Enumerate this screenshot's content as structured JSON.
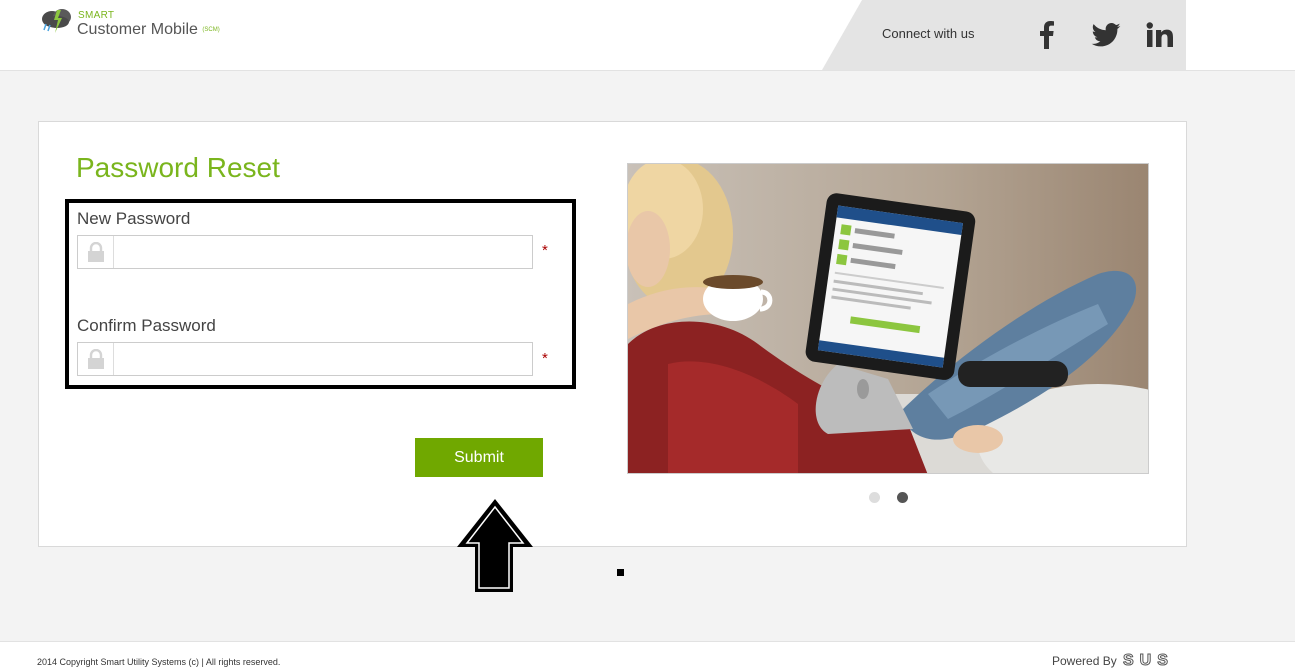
{
  "header": {
    "logo": {
      "smart": "SMART",
      "name": "Customer Mobile",
      "abbr": "(SCM)"
    },
    "connect_text": "Connect with us",
    "social": [
      {
        "icon": "facebook-icon",
        "label": "f"
      },
      {
        "icon": "twitter-icon"
      },
      {
        "icon": "linkedin-icon",
        "label": "in"
      }
    ]
  },
  "form": {
    "title": "Password Reset",
    "new_password": {
      "label": "New Password",
      "value": "",
      "required_mark": "*"
    },
    "confirm_password": {
      "label": "Confirm Password",
      "value": "",
      "required_mark": "*"
    },
    "submit_label": "Submit"
  },
  "carousel": {
    "slides": 2,
    "active_index": 1
  },
  "footer": {
    "copyright": "2014 Copyright Smart Utility Systems (c) | All rights reserved.",
    "powered_by": "Powered By",
    "powered_logo": "SUS"
  },
  "colors": {
    "brand_green": "#7ab51d",
    "button_green": "#70a800",
    "required_red": "#aa0000"
  }
}
